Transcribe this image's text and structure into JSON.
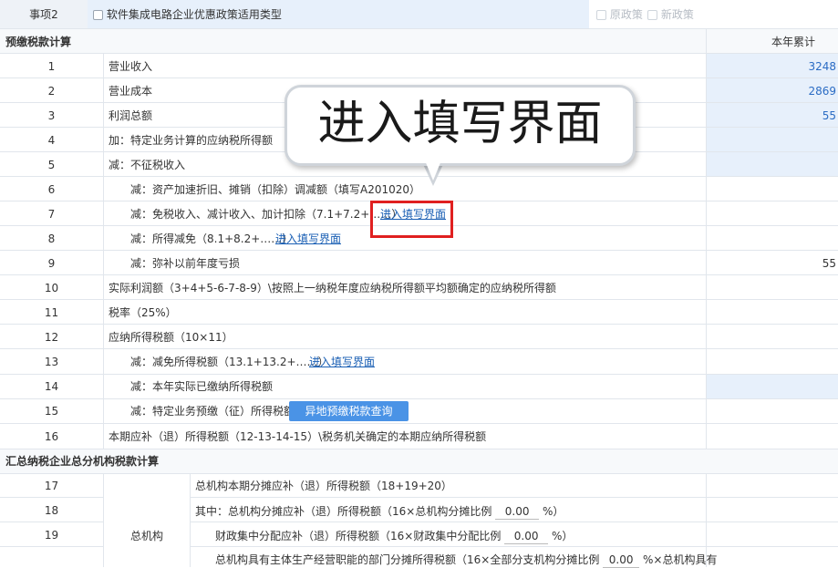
{
  "top": {
    "item_label": "事项2",
    "policy_checkbox_label": "软件集成电路企业优惠政策适用类型",
    "old_policy": "原政策",
    "new_policy": "新政策"
  },
  "section1": {
    "title": "预缴税款计算",
    "col_header": "本年累计",
    "rows": [
      {
        "no": "1",
        "label": "营业收入",
        "value": "3248"
      },
      {
        "no": "2",
        "label": "营业成本",
        "value": "2869"
      },
      {
        "no": "3",
        "label": "利润总额",
        "value": "55"
      },
      {
        "no": "4",
        "label": "加：特定业务计算的应纳税所得额",
        "value": ""
      },
      {
        "no": "5",
        "label": "减：不征税收入",
        "value": ""
      },
      {
        "no": "6",
        "label": "减：资产加速折旧、摊销（扣除）调减额（填写A201020）",
        "value": ""
      },
      {
        "no": "7",
        "label": "减：免税收入、减计收入、加计扣除（7.1+7.2+……）",
        "link": "进入填写界面",
        "value": ""
      },
      {
        "no": "8",
        "label": "减：所得减免（8.1+8.2+……）",
        "link": "进入填写界面",
        "value": ""
      },
      {
        "no": "9",
        "label": "减：弥补以前年度亏损",
        "value": "55"
      },
      {
        "no": "10",
        "label": "实际利润额（3+4+5-6-7-8-9）\\按照上一纳税年度应纳税所得额平均额确定的应纳税所得额",
        "value": ""
      },
      {
        "no": "11",
        "label": "税率（25%）",
        "value": ""
      },
      {
        "no": "12",
        "label": "应纳所得税额（10×11）",
        "value": ""
      },
      {
        "no": "13",
        "label": "减：减免所得税额（13.1+13.2+……）",
        "link": "进入填写界面",
        "value": ""
      },
      {
        "no": "14",
        "label": "减：本年实际已缴纳所得税额",
        "value": ""
      },
      {
        "no": "15",
        "label": "减：特定业务预缴（征）所得税额",
        "button": "异地预缴税款查询",
        "value": ""
      },
      {
        "no": "16",
        "label": "本期应补（退）所得税额（12-13-14-15）\\税务机关确定的本期应纳所得税额",
        "value": ""
      }
    ]
  },
  "section2": {
    "title": "汇总纳税企业总分机构税款计算",
    "group_label": "总机构",
    "rows": [
      {
        "no": "17",
        "label": "总机构本期分摊应补（退）所得税额（18+19+20）"
      },
      {
        "no": "18",
        "label_pre": "其中：总机构分摊应补（退）所得税额（16×总机构分摊比例",
        "ratio": "0.00",
        "label_post": "%）"
      },
      {
        "no": "19",
        "label_pre": "财政集中分配应补（退）所得税额（16×财政集中分配比例",
        "ratio": "0.00",
        "label_post": "%）"
      },
      {
        "no": "",
        "label_pre": "总机构具有主体生产经营职能的部门分摊所得税额（16×全部分支机构分摊比例",
        "ratio": "0.00",
        "label_post": "%×总机构具有"
      }
    ]
  },
  "callout": {
    "text": "进入填写界面"
  },
  "colors": {
    "accent_blue": "#4a93e6",
    "value_blue": "#2b6cc4",
    "highlight_red": "#e02020",
    "cell_fill": "#e7f0fb"
  }
}
